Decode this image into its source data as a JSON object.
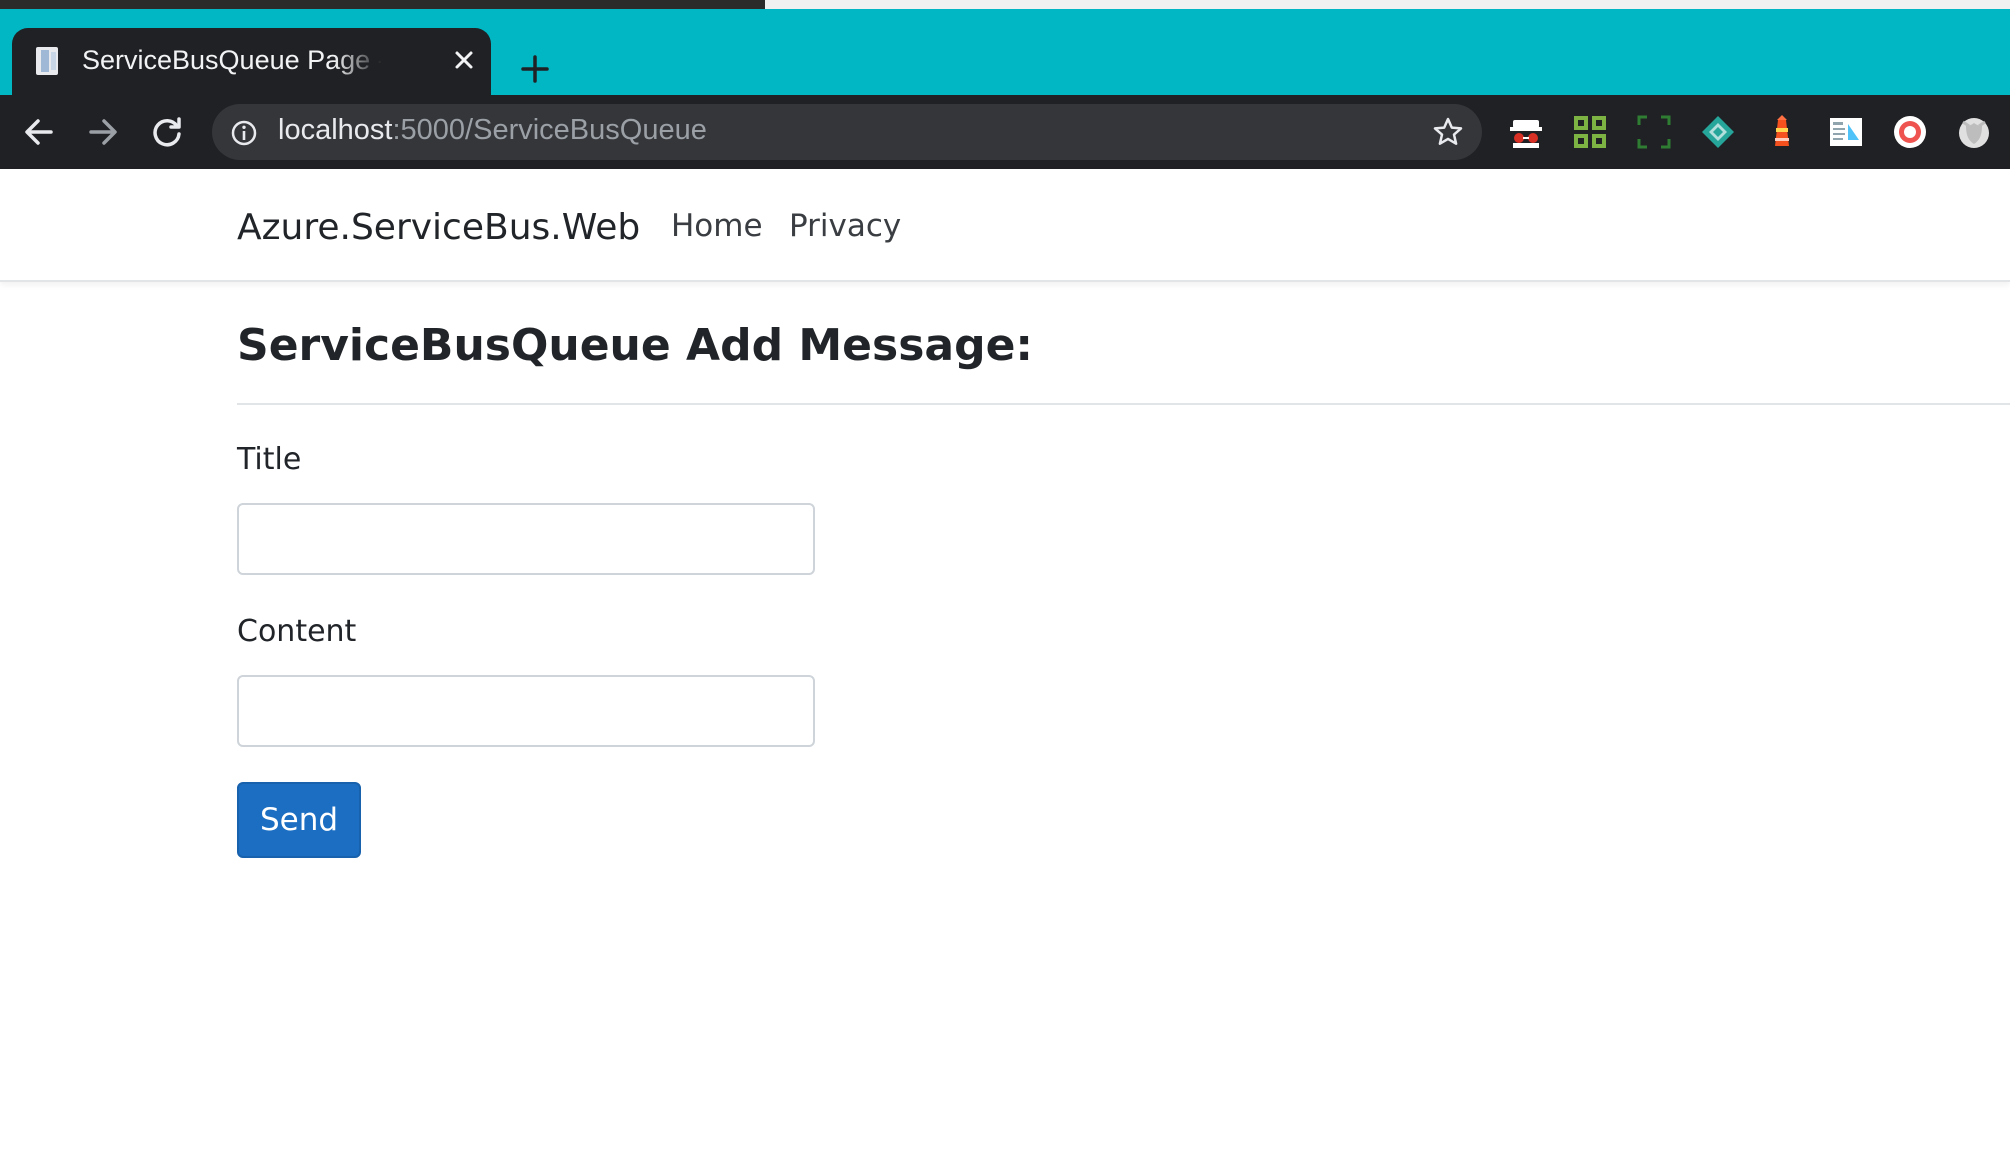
{
  "browser": {
    "tab": {
      "title": "ServiceBusQueue Page - Azure.ServiceBus.Web"
    },
    "address": {
      "host": "localhost",
      "path": ":5000/ServiceBusQueue"
    },
    "accent_color": "#00b7c3",
    "extensions": [
      "incognito-icon",
      "qr-code-icon",
      "screenshot-icon",
      "diamond-extension-icon",
      "lighthouse-icon",
      "reader-icon",
      "record-icon",
      "shield-icon"
    ]
  },
  "navbar": {
    "brand": "Azure.ServiceBus.Web",
    "links": [
      "Home",
      "Privacy"
    ]
  },
  "main": {
    "heading": "ServiceBusQueue Add Message:",
    "form": {
      "title_label": "Title",
      "title_value": "",
      "content_label": "Content",
      "content_value": "",
      "send_label": "Send"
    },
    "button_color": "#1b6ec2"
  }
}
